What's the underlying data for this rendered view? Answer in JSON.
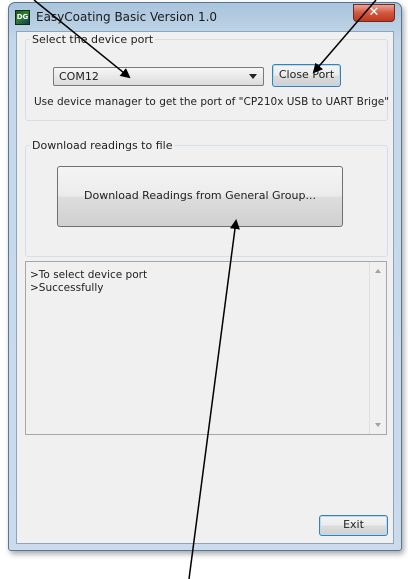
{
  "window": {
    "title": "EasyCoating Basic Version 1.0",
    "app_icon_text": "DG",
    "close_glyph": "✕"
  },
  "port_group": {
    "legend": "Select the device port",
    "selected_port": "COM12",
    "close_port_label": "Close Port",
    "hint": "Use device manager to get the port of \"CP210x USB to UART Brige\""
  },
  "download_group": {
    "legend": "Download readings to file",
    "download_label": "Download Readings from General Group..."
  },
  "log": {
    "lines": [
      ">To select device port",
      ">Successfully"
    ]
  },
  "footer": {
    "exit_label": "Exit"
  },
  "colors": {
    "title_bar": "#c5d8ea",
    "close_button": "#c0391f",
    "dialog_bg": "#f0f0f0",
    "focus_border": "#3c7fb1"
  },
  "icons": [
    "app-icon",
    "close-icon",
    "chevron-down-icon",
    "scroll-up-icon",
    "scroll-down-icon"
  ]
}
